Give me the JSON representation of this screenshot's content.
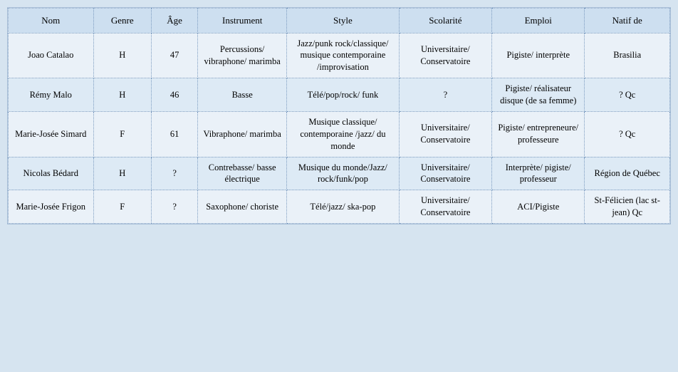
{
  "table": {
    "headers": [
      "Nom",
      "Genre",
      "Âge",
      "Instrument",
      "Style",
      "Scolarité",
      "Emploi",
      "Natif de"
    ],
    "rows": [
      {
        "nom": "Joao Catalao",
        "genre": "H",
        "age": "47",
        "instrument": "Percussions/ vibraphone/ marimba",
        "style": "Jazz/punk rock/classique/ musique contemporaine /improvisation",
        "scolarite": "Universitaire/ Conservatoire",
        "emploi": "Pigiste/ interprète",
        "natif": "Brasilia"
      },
      {
        "nom": "Rémy Malo",
        "genre": "H",
        "age": "46",
        "instrument": "Basse",
        "style": "Télé/pop/rock/ funk",
        "scolarite": "?",
        "emploi": "Pigiste/ réalisateur disque (de sa femme)",
        "natif": "? Qc"
      },
      {
        "nom": "Marie-Josée Simard",
        "genre": "F",
        "age": "61",
        "instrument": "Vibraphone/ marimba",
        "style": "Musique classique/ contemporaine /jazz/ du monde",
        "scolarite": "Universitaire/ Conservatoire",
        "emploi": "Pigiste/ entrepreneure/ professeure",
        "natif": "? Qc"
      },
      {
        "nom": "Nicolas Bédard",
        "genre": "H",
        "age": "?",
        "instrument": "Contrebasse/ basse électrique",
        "style": "Musique du monde/Jazz/ rock/funk/pop",
        "scolarite": "Universitaire/ Conservatoire",
        "emploi": "Interprète/ pigiste/ professeur",
        "natif": "Région de Québec"
      },
      {
        "nom": "Marie-Josée Frigon",
        "genre": "F",
        "age": "?",
        "instrument": "Saxophone/ choriste",
        "style": "Télé/jazz/ ska-pop",
        "scolarite": "Universitaire/ Conservatoire",
        "emploi": "ACI/Pigiste",
        "natif": "St-Félicien (lac st-jean) Qc"
      }
    ]
  }
}
